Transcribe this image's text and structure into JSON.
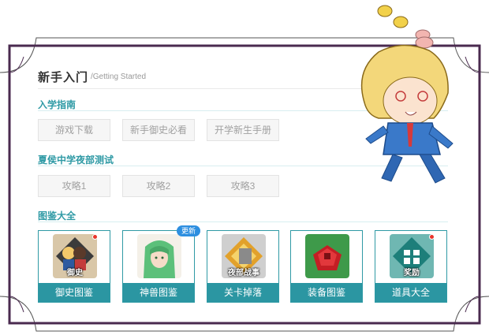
{
  "header": {
    "title": "新手入门",
    "subtitle": "/Getting Started"
  },
  "sections": [
    {
      "title": "入学指南",
      "buttons": [
        "游戏下载",
        "新手御史必看",
        "开学新生手册"
      ]
    },
    {
      "title": "夏侯中学夜部测试",
      "buttons": [
        "攻略1",
        "攻略2",
        "攻略3"
      ]
    },
    {
      "title": "图鉴大全"
    }
  ],
  "cards": [
    {
      "label": "御史图鉴",
      "thumb_caption": "御史",
      "icon": "characters-thumbnail",
      "has_dot": true
    },
    {
      "label": "神兽图鉴",
      "thumb_caption": "",
      "icon": "green-hair-beast-thumbnail",
      "has_dot": false,
      "badge": "更新"
    },
    {
      "label": "关卡掉落",
      "thumb_caption": "夜部战事",
      "icon": "battle-thumbnail",
      "has_dot": false
    },
    {
      "label": "装备图鉴",
      "thumb_caption": "",
      "icon": "red-bag-thumbnail",
      "has_dot": false
    },
    {
      "label": "道具大全",
      "thumb_caption": "奖励",
      "icon": "gift-thumbnail",
      "has_dot": true
    }
  ],
  "colors": {
    "accent": "#2b96a2",
    "frame": "#4a2a4f",
    "badge": "#2d8fe0",
    "dot": "#e8352c"
  }
}
